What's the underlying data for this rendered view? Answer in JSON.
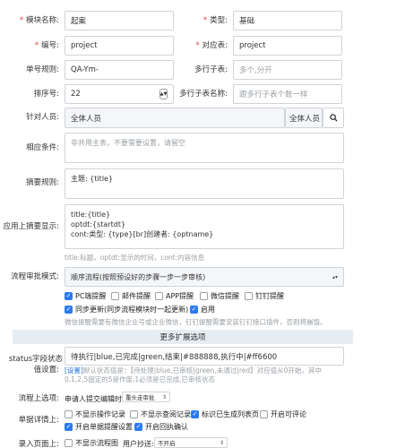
{
  "fields": {
    "module_name": {
      "label": "模块名称:",
      "value": "起案"
    },
    "type": {
      "label": "类型:",
      "value": "基础"
    },
    "code": {
      "label": "编号:",
      "value": "project"
    },
    "table": {
      "label": "对应表:",
      "value": "project"
    },
    "doc_rule": {
      "label": "单号规则:",
      "value": "QA-Ym-"
    },
    "multi_table": {
      "label": "多行子表:",
      "placeholder": "多个,分开"
    },
    "sort": {
      "label": "排序号:",
      "value": "22"
    },
    "multi_table_name": {
      "label": "多行子表名称:",
      "placeholder": "跟多行子表个数一样"
    },
    "target": {
      "label": "针对人员:",
      "value": "全体人员",
      "addon": "全体人员"
    },
    "condition": {
      "label": "相应条件:",
      "placeholder": "非共用主表，不要需要设置，请留空"
    },
    "summary": {
      "label": "摘要规则:",
      "value": "主题: {title}"
    },
    "app_summary": {
      "label": "应用上摘要显示:",
      "lines": [
        "title:{title}",
        "optdt:{startdt}",
        "cont:类型: {type}[br]创建者: {optname}"
      ],
      "hint": "title:标题，optdt:显示的时间，cont:内容信息"
    },
    "flow_mode": {
      "label": "流程审批模式:",
      "value": "顺序流程(按照预设好的步骤一步一步审核)"
    }
  },
  "notify": {
    "items": [
      {
        "label": "PC端提醒",
        "checked": true
      },
      {
        "label": "邮件提醒",
        "checked": false
      },
      {
        "label": "APP提醒",
        "checked": false
      },
      {
        "label": "微信提醒",
        "checked": false
      },
      {
        "label": "钉钉提醒",
        "checked": false
      }
    ],
    "sync": {
      "label": "同步更新(同步流程模块时一起更新)",
      "checked": true
    },
    "enable": {
      "label": "启用",
      "checked": true
    },
    "hint": "微信提醒需要有微信企业号或企业微信，钉钉提醒需要安装钉钉接口插件，否则将崩毁。"
  },
  "more_section": "更多扩展选项",
  "status": {
    "label1": "status字段状态",
    "label2": "值设置:",
    "value": "待执行|blue,已完成|green,结束|#888888,执行中|#ff6600",
    "hint_prefix": "[设置]",
    "hint": "默认状态值是：【待处理|blue,已审核|green,未通过|red】对应值从0开始，其中0,1,2,5固定的5是作废,1必须是已完成,已审核状态"
  },
  "flow_options": {
    "label": "流程上选项:",
    "edit_label": "申请人提交编辑时:",
    "edit_value": "重头走审批"
  },
  "detail": {
    "label": "单据详情上:",
    "row1": [
      {
        "label": "不显示操作记录",
        "checked": false
      },
      {
        "label": "不显示查阅记录",
        "checked": false
      },
      {
        "label": "标识已生成列表页",
        "checked": true
      },
      {
        "label": "开启可评论",
        "checked": false
      }
    ],
    "row2": [
      {
        "label": "开启单据提醒设置",
        "checked": true
      },
      {
        "label": "开启回执确认",
        "checked": true
      }
    ]
  },
  "entry": {
    "label": "录入页面上:",
    "no_chart": {
      "label": "不显示流程图",
      "checked": false
    },
    "cc_label": "用户抄送:",
    "cc_value": "不开启"
  },
  "colors": {
    "accent": "#2b7bf3",
    "required": "#e4393c",
    "section": "#e6edf2"
  }
}
